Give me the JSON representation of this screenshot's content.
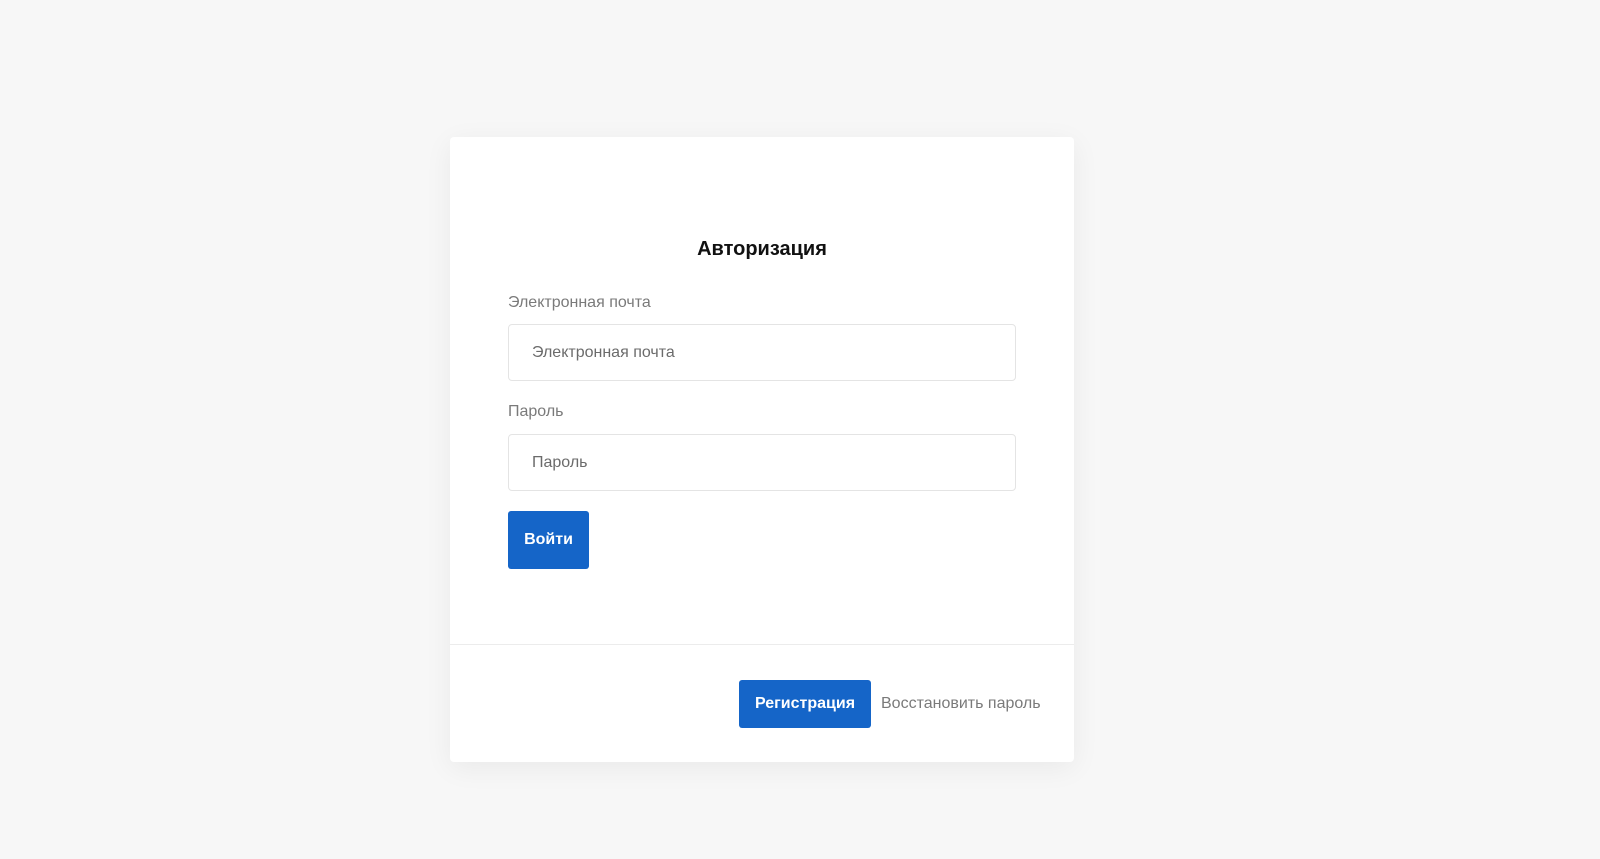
{
  "auth": {
    "title": "Авторизация",
    "email_label": "Электронная почта",
    "email_placeholder": "Электронная почта",
    "email_value": "",
    "password_label": "Пароль",
    "password_placeholder": "Пароль",
    "password_value": "",
    "login_button": "Войти"
  },
  "footer": {
    "register_button": "Регистрация",
    "restore_link": "Восстановить пароль"
  },
  "colors": {
    "page_background": "#f7f7f7",
    "card_background": "#ffffff",
    "primary_button": "#1565c8",
    "muted_text": "#7a7a7a"
  }
}
